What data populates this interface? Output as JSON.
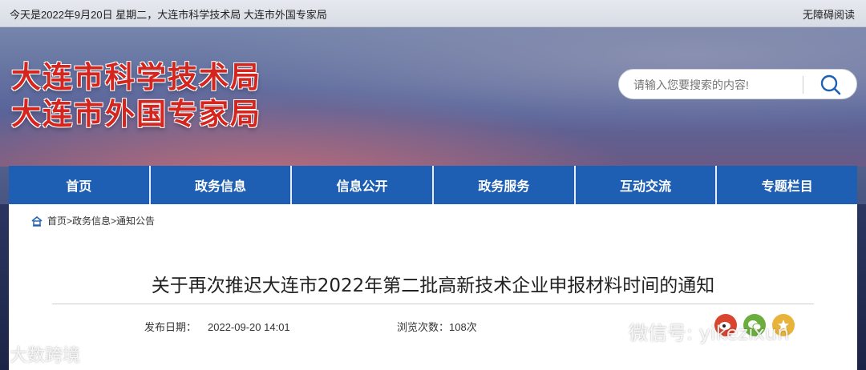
{
  "topbar": {
    "date_text": "今天是2022年9月20日  星期二，大连市科学技术局  大连市外国专家局",
    "accessibility": "无障碍阅读"
  },
  "banner": {
    "title_line1": "大连市科学技术局",
    "title_line2": "大连市外国专家局"
  },
  "search": {
    "placeholder": "请输入您要搜索的内容!",
    "icon": "search-icon"
  },
  "nav": {
    "items": [
      "首页",
      "政务信息",
      "信息公开",
      "政务服务",
      "互动交流",
      "专题栏目"
    ]
  },
  "breadcrumb": {
    "text": "首页>政务信息>通知公告",
    "icon": "home-icon"
  },
  "article": {
    "title": "关于再次推迟大连市2022年第二批高新技术企业申报材料时间的通知",
    "publish_label": "发布日期：",
    "publish_date": "2022-09-20  14:01",
    "views_label": "浏览次数：",
    "views_count": "108次"
  },
  "share_icons": [
    "weibo-icon",
    "wechat-icon",
    "qzone-icon"
  ],
  "watermarks": {
    "left": "大数跨境",
    "right": "微信号: yikezixun"
  },
  "colors": {
    "nav_blue": "#1e5fb3",
    "title_red": "#d4261f",
    "weibo": "#d9452f",
    "wechat": "#6cae3e",
    "qzone": "#e8b33a"
  }
}
